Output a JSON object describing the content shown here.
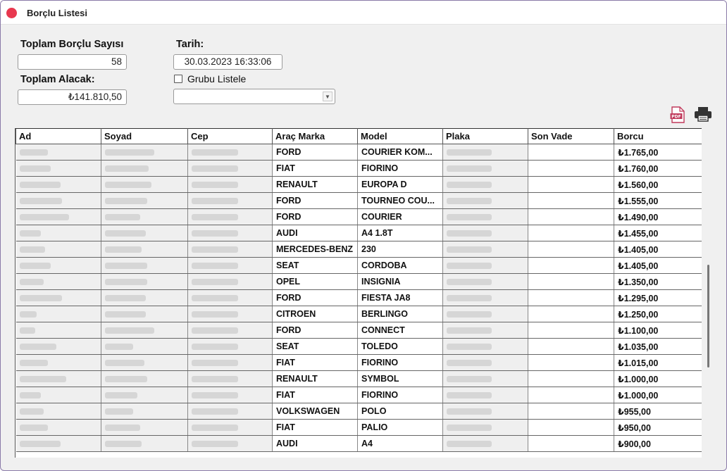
{
  "window": {
    "title": "Borçlu Listesi"
  },
  "summary": {
    "toplam_borclu_label": "Toplam Borçlu Sayısı",
    "toplam_borclu_value": "58",
    "toplam_alacak_label": "Toplam Alacak:",
    "toplam_alacak_value": "₺141.810,50",
    "tarih_label": "Tarih:",
    "tarih_value": "30.03.2023 16:33:06",
    "grubu_listele_label": "Grubu Listele",
    "grubu_listele_checked": false,
    "group_select_value": ""
  },
  "toolbar": {
    "pdf_icon": "pdf-icon",
    "print_icon": "printer-icon"
  },
  "table": {
    "columns": [
      "Ad",
      "Soyad",
      "Cep",
      "Araç Marka",
      "Model",
      "Plaka",
      "Son Vade",
      "Borcu"
    ],
    "rows": [
      {
        "marka": "FORD",
        "model": "COURIER KOM...",
        "son_vade": "",
        "borcu": "₺1.765,00"
      },
      {
        "marka": "FIAT",
        "model": "FIORINO",
        "son_vade": "",
        "borcu": "₺1.760,00"
      },
      {
        "marka": "RENAULT",
        "model": "EUROPA D",
        "son_vade": "",
        "borcu": "₺1.560,00"
      },
      {
        "marka": "FORD",
        "model": "TOURNEO COU...",
        "son_vade": "",
        "borcu": "₺1.555,00"
      },
      {
        "marka": "FORD",
        "model": "COURIER",
        "son_vade": "",
        "borcu": "₺1.490,00"
      },
      {
        "marka": "AUDI",
        "model": "A4 1.8T",
        "son_vade": "",
        "borcu": "₺1.455,00"
      },
      {
        "marka": "MERCEDES-BENZ",
        "model": "230",
        "son_vade": "",
        "borcu": "₺1.405,00"
      },
      {
        "marka": "SEAT",
        "model": "CORDOBA",
        "son_vade": "",
        "borcu": "₺1.405,00"
      },
      {
        "marka": "OPEL",
        "model": "INSIGNIA",
        "son_vade": "",
        "borcu": "₺1.350,00"
      },
      {
        "marka": "FORD",
        "model": "FIESTA JA8",
        "son_vade": "",
        "borcu": "₺1.295,00"
      },
      {
        "marka": "CITROEN",
        "model": "BERLINGO",
        "son_vade": "",
        "borcu": "₺1.250,00"
      },
      {
        "marka": "FORD",
        "model": "CONNECT",
        "son_vade": "",
        "borcu": "₺1.100,00"
      },
      {
        "marka": "SEAT",
        "model": "TOLEDO",
        "son_vade": "",
        "borcu": "₺1.035,00"
      },
      {
        "marka": "FIAT",
        "model": "FIORINO",
        "son_vade": "",
        "borcu": "₺1.015,00"
      },
      {
        "marka": "RENAULT",
        "model": "SYMBOL",
        "son_vade": "",
        "borcu": "₺1.000,00"
      },
      {
        "marka": "FIAT",
        "model": "FIORINO",
        "son_vade": "",
        "borcu": "₺1.000,00"
      },
      {
        "marka": "VOLKSWAGEN",
        "model": "POLO",
        "son_vade": "",
        "borcu": "₺955,00"
      },
      {
        "marka": "FIAT",
        "model": "PALIO",
        "son_vade": "",
        "borcu": "₺950,00"
      },
      {
        "marka": "AUDI",
        "model": "A4",
        "son_vade": "",
        "borcu": "₺900,00"
      }
    ]
  },
  "colors": {
    "close_button": "#e8384f",
    "pdf_icon": "#c0395b",
    "window_border": "#8a7aa8"
  }
}
